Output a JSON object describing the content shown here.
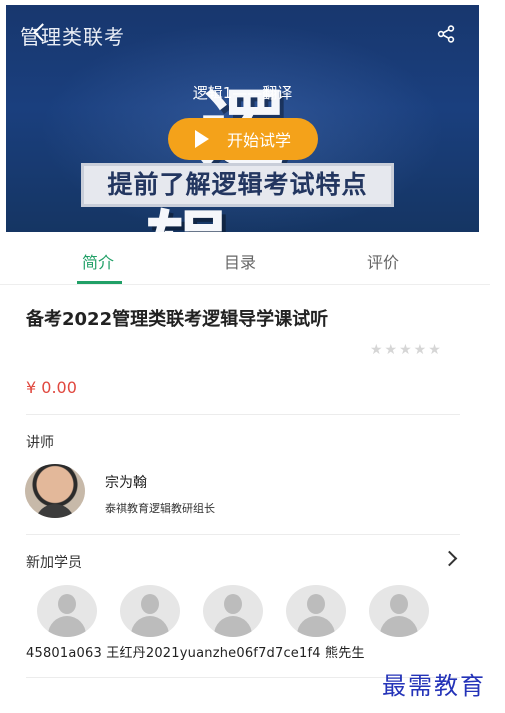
{
  "header": {
    "app_title": "管理类联考",
    "icons": {
      "back": "back-arrow-icon",
      "share": "share-icon"
    }
  },
  "banner": {
    "video_title": "逻辑1——翻译",
    "big_word": "逻辑",
    "play_label": "开始试学",
    "slogan": "提前了解逻辑考试特点",
    "play_color": "#f4a21a",
    "bg_color": "#1a3f7e"
  },
  "tabs": [
    {
      "label": "简介",
      "active": true
    },
    {
      "label": "目录",
      "active": false
    },
    {
      "label": "评价",
      "active": false
    }
  ],
  "accent_color": "#21a067",
  "course": {
    "title": "备考2022管理类联考逻辑导学课试听",
    "rating_stars": 5,
    "rating_value": 0,
    "price": "¥ 0.00",
    "price_color": "#e0483f"
  },
  "teacher": {
    "section_label": "讲师",
    "name": "宗为翰",
    "role": "泰祺教育逻辑教研组长"
  },
  "students": {
    "section_label": "新加学员",
    "names_line": "45801a063 王红丹2021yuanzhe06f7d7ce1f4   熊先生"
  },
  "watermark": "最需教育"
}
